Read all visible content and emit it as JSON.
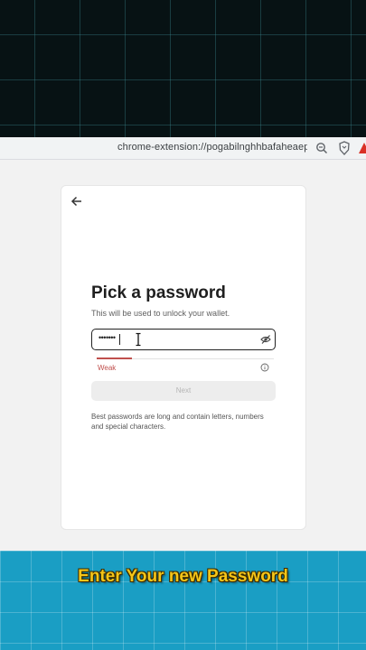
{
  "browser": {
    "url": "chrome-extension://pogabilnghhbafaheaep...",
    "icons": [
      "zoom-out-icon",
      "brave-shield-icon",
      "warning-icon"
    ]
  },
  "wallet": {
    "back_icon": "arrow-left-icon",
    "title": "Pick a password",
    "subtitle": "This will be used to unlock your wallet.",
    "password": {
      "value": "•••••••",
      "visibility_icon": "eye-off-icon"
    },
    "strength": {
      "label": "Weak",
      "level": 0.2,
      "color": "#c0504d",
      "info_icon": "info-icon"
    },
    "next_label": "Next",
    "hint": "Best passwords are long and contain letters, numbers and special characters."
  },
  "caption": {
    "text": "Enter Your new Password",
    "color": "#f5c518"
  }
}
